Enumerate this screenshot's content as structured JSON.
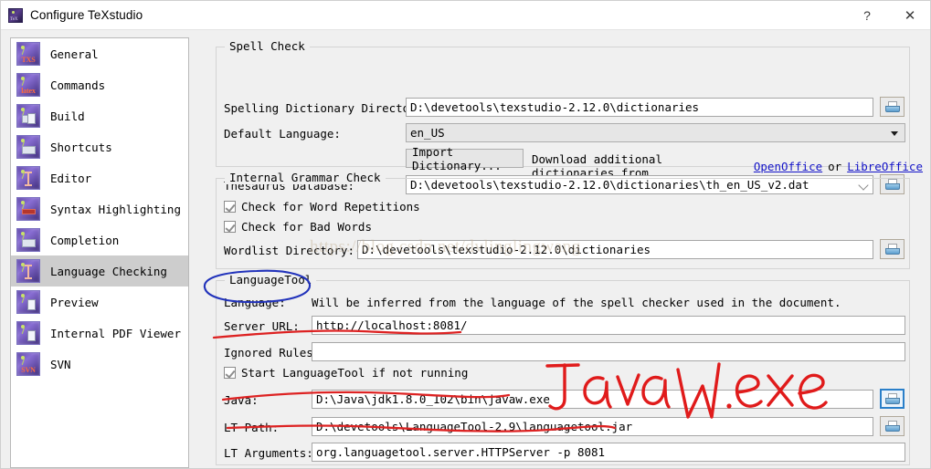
{
  "window": {
    "title": "Configure TeXstudio",
    "icon": "texstudio-icon",
    "help_button": "?",
    "close_button": "✕"
  },
  "sidebar": {
    "items": [
      {
        "label": "General",
        "icon": "txs-icon",
        "selected": false
      },
      {
        "label": "Commands",
        "icon": "latex-icon",
        "selected": false
      },
      {
        "label": "Build",
        "icon": "build-icon",
        "selected": false
      },
      {
        "label": "Shortcuts",
        "icon": "keyboard-icon",
        "selected": false
      },
      {
        "label": "Editor",
        "icon": "text-cursor-icon",
        "selected": false
      },
      {
        "label": "Syntax Highlighting",
        "icon": "highlight-icon",
        "selected": false
      },
      {
        "label": "Completion",
        "icon": "completion-icon",
        "selected": false
      },
      {
        "label": "Language Checking",
        "icon": "language-icon",
        "selected": true
      },
      {
        "label": "Preview",
        "icon": "preview-icon",
        "selected": false
      },
      {
        "label": "Internal PDF Viewer",
        "icon": "pdf-viewer-icon",
        "selected": false
      },
      {
        "label": "SVN",
        "icon": "svn-icon",
        "selected": false
      }
    ]
  },
  "spell_check": {
    "group_title": "Spell Check",
    "dictionary_dirs_label": "Spelling Dictionary Directories:",
    "dictionary_dirs_value": "D:\\devetools\\texstudio-2.12.0\\dictionaries",
    "dictionary_dirs_browse": "browse-folder-icon",
    "default_language_label": "Default Language:",
    "default_language_value": "en_US",
    "import_dictionary_button": "Import Dictionary...",
    "download_prefix": "Download additional dictionaries from",
    "openoffice_link": "OpenOffice",
    "or_text": "or",
    "libreoffice_link": "LibreOffice",
    "thesaurus_label": "Thesaurus Database:",
    "thesaurus_value": "D:\\devetools\\texstudio-2.12.0\\dictionaries\\th_en_US_v2.dat",
    "thesaurus_browse": "browse-folder-icon"
  },
  "grammar_check": {
    "group_title": "Internal Grammar Check",
    "word_repetitions_label": "Check for Word Repetitions",
    "word_repetitions_checked": true,
    "bad_words_label": "Check for Bad Words",
    "bad_words_checked": true,
    "wordlist_label": "Wordlist Directory:",
    "wordlist_value": "D:\\devetools\\texstudio-2.12.0\\dictionaries",
    "wordlist_browse": "browse-folder-icon"
  },
  "language_tool": {
    "group_title": "LanguageTool",
    "language_label": "Language:",
    "language_hint": "Will be inferred from the language of the spell checker used in the document.",
    "server_url_label": "Server URL:",
    "server_url_value": "http://localhost:8081/",
    "ignored_rules_label": "Ignored Rules:",
    "ignored_rules_value": "",
    "start_lt_label": "Start LanguageTool if not running",
    "start_lt_checked": true,
    "java_label": "Java:",
    "java_value": "D:\\Java\\jdk1.8.0_102\\bin\\javaw.exe",
    "java_browse": "browse-folder-icon",
    "lt_path_label": "LT Path:",
    "lt_path_value": "D:\\devetools\\LanguageTool-2.9\\languagetool.jar",
    "lt_path_browse": "browse-folder-icon",
    "lt_arguments_label": "LT Arguments:",
    "lt_arguments_value": "org.languagetool.server.HTTPServer -p 8081"
  },
  "annotations": {
    "handwriting_text": "Javaw.exe",
    "handwriting_color": "#e01b1b",
    "ellipse_color": "#2233bb",
    "underline_color": "#dd2222"
  },
  "watermark": {
    "text": "https://blog.csdn.net/dvlinglingwang"
  }
}
